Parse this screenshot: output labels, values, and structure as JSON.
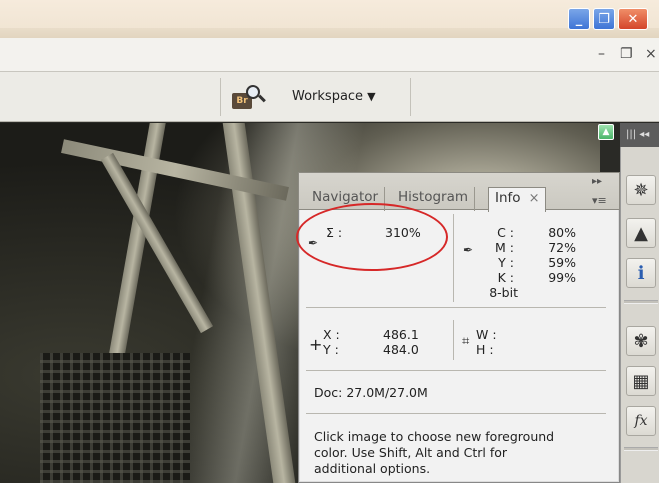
{
  "window": {
    "controls": {
      "minimize": "_",
      "maximize": "❐",
      "close": "✕"
    }
  },
  "doc_controls": {
    "minimize": "–",
    "restore": "❐",
    "close": "×"
  },
  "options_bar": {
    "bridge_label": "Br",
    "workspace_label": "Workspace",
    "workspace_arrow": "▼"
  },
  "dock": {
    "collapse_label": "|||  ◂◂",
    "tools": [
      {
        "name": "navigator-wheel-icon",
        "glyph": "✵"
      },
      {
        "name": "histogram-icon",
        "glyph": "▲"
      },
      {
        "name": "info-icon",
        "glyph": "ℹ"
      },
      {
        "name": "color-palette-icon",
        "glyph": "✾"
      },
      {
        "name": "swatches-icon",
        "glyph": "▦"
      },
      {
        "name": "styles-fx-icon",
        "glyph": "fx"
      }
    ]
  },
  "info_panel": {
    "menu_arrows": "▸▸",
    "flyout": "▾≡",
    "tabs": [
      {
        "label": "Navigator",
        "active": false
      },
      {
        "label": "Histogram",
        "active": false
      },
      {
        "label": "Info",
        "active": true
      }
    ],
    "tab_close": "×",
    "sigma": {
      "label": "Σ :",
      "value": "310%"
    },
    "cmyk": {
      "labels": [
        "C :",
        "M :",
        "Y :",
        "K :"
      ],
      "values": [
        "80%",
        "72%",
        "59%",
        "99%"
      ],
      "bit_depth": "8-bit"
    },
    "position": {
      "x_label": "X :",
      "y_label": "Y :",
      "x_value": "486.1",
      "y_value": "484.0"
    },
    "size": {
      "w_label": "W :",
      "h_label": "H :"
    },
    "doc": "Doc: 27.0M/27.0M",
    "hint_lines": [
      "Click image to choose new foreground",
      "color.  Use Shift, Alt and Ctrl for",
      "additional options."
    ]
  },
  "colors": {
    "annotation": "#d62828",
    "close_button": "#d4452a",
    "win_button": "#3e74d6"
  }
}
